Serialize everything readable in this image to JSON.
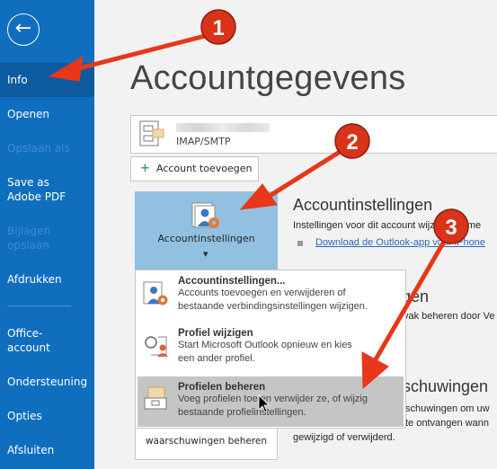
{
  "sidebar": {
    "back_icon": "arrow-left-circle-icon",
    "items": [
      {
        "label": "Info",
        "state": "selected"
      },
      {
        "label": "Openen",
        "state": "normal"
      },
      {
        "label": "Opslaan als",
        "state": "disabled"
      },
      {
        "label": "Save as Adobe PDF",
        "state": "normal"
      },
      {
        "label": "Bijlagen opslaan",
        "state": "disabled"
      },
      {
        "label": "Afdrukken",
        "state": "normal"
      },
      {
        "label": "Office-account",
        "state": "normal"
      },
      {
        "label": "Ondersteuning",
        "state": "normal"
      },
      {
        "label": "Opties",
        "state": "normal"
      },
      {
        "label": "Afsluiten",
        "state": "normal"
      }
    ]
  },
  "main": {
    "title": "Accountgegevens",
    "account": {
      "type": "IMAP/SMTP"
    },
    "add_account": "Account toevoegen",
    "settings_button": "Accountinstellingen",
    "settings": {
      "heading": "Accountinstellingen",
      "desc": "Instellingen voor dit account wijzigen of me",
      "link": "Download de Outlook-app voor iPhone"
    },
    "section2": {
      "heading": "gen",
      "desc": "vak beheren door Ve"
    },
    "section3": {
      "heading": "schuwingen",
      "lines": [
        "schuwingen om uw",
        "te ontvangen wann",
        "gewijzigd of verwijderd."
      ]
    },
    "warn_button": "waarschuwingen beheren"
  },
  "menu": {
    "items": [
      {
        "title": "Accountinstellingen...",
        "desc1": "Accounts toevoegen en verwijderen of",
        "desc2": "bestaande verbindingsinstellingen wijzigen."
      },
      {
        "title": "Profiel wijzigen",
        "desc1": "Start  Microsoft Outlook opnieuw en kies",
        "desc2": "een ander profiel."
      },
      {
        "title": "Profielen beheren",
        "desc1": "Voeg profielen toe en verwijder ze, of wijzig",
        "desc2": "bestaande profielinstellingen."
      }
    ]
  },
  "annotations": {
    "badges": [
      "1",
      "2",
      "3"
    ],
    "color": "#e8371a"
  },
  "colors": {
    "sidebar": "#106ebe",
    "selected": "#0d5aa0",
    "button": "#91c0e0",
    "highlight": "#c5c5c5"
  }
}
